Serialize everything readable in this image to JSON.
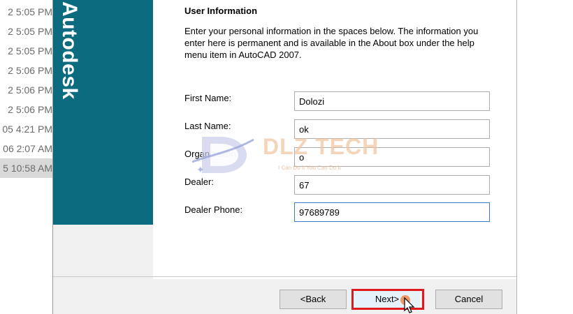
{
  "background_list": {
    "rows": [
      {
        "text": "2 5:05 PM",
        "selected": false
      },
      {
        "text": "2 5:05 PM",
        "selected": false
      },
      {
        "text": "2 5:05 PM",
        "selected": false
      },
      {
        "text": "2 5:06 PM",
        "selected": false
      },
      {
        "text": "2 5:06 PM",
        "selected": false
      },
      {
        "text": "2 5:06 PM",
        "selected": false
      },
      {
        "text": "05 4:21 PM",
        "selected": false
      },
      {
        "text": "06 2:07 AM",
        "selected": false
      },
      {
        "text": "5 10:58 AM",
        "selected": true
      }
    ]
  },
  "brand": {
    "name": "Autodesk",
    "color": "#0d6b80"
  },
  "section": {
    "title": "User Information",
    "intro": "Enter your personal information in the spaces below. The information you enter here is permanent and is available in the About box under the help menu item in AutoCAD 2007."
  },
  "form": {
    "fields": [
      {
        "label": "First Name:",
        "value": "Dolozi"
      },
      {
        "label": "Last Name:",
        "value": "ok"
      },
      {
        "label": "Organization:",
        "value": "o"
      },
      {
        "label": "Dealer:",
        "value": "67"
      },
      {
        "label": "Dealer Phone:",
        "value": "97689789"
      }
    ]
  },
  "watermark": {
    "text": "DLZ TECH",
    "slogan": "I Can Do It You Can Do It"
  },
  "buttons": {
    "back": "<Back",
    "next": "Next>",
    "cancel": "Cancel"
  },
  "colors": {
    "highlight": "#e0191d",
    "focus_border": "#3a78c9"
  }
}
